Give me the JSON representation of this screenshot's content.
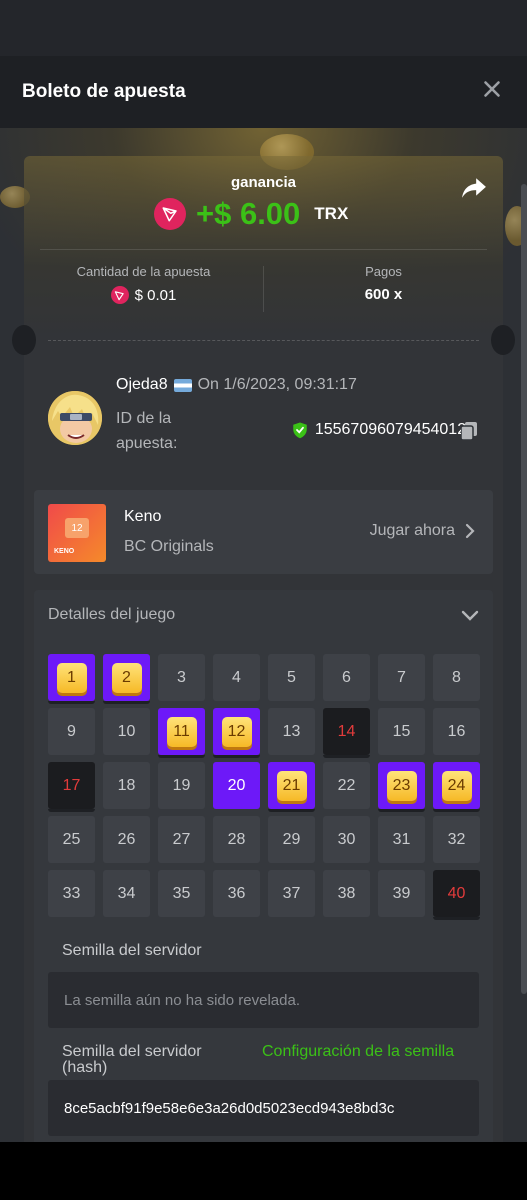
{
  "header": {
    "title": "Boleto de apuesta"
  },
  "win": {
    "label": "ganancia",
    "amount": "+$ 6.00",
    "currency": "TRX"
  },
  "stats": {
    "bet_label": "Cantidad de la apuesta",
    "bet_value": "$ 0.01",
    "payout_label": "Pagos",
    "payout_value": "600 x"
  },
  "player": {
    "name": "Ojeda8",
    "date": "On 1/6/2023, 09:31:17",
    "id_label": "ID de la apuesta:",
    "id_value": "155670960794540128"
  },
  "game": {
    "name": "Keno",
    "provider": "BC Originals",
    "play_label": "Jugar ahora",
    "thumb_number": "12",
    "thumb_label": "KENO"
  },
  "details": {
    "title": "Detalles del juego",
    "cells": [
      {
        "n": "1",
        "state": "hit"
      },
      {
        "n": "2",
        "state": "hit"
      },
      {
        "n": "3",
        "state": "none"
      },
      {
        "n": "4",
        "state": "none"
      },
      {
        "n": "5",
        "state": "none"
      },
      {
        "n": "6",
        "state": "none"
      },
      {
        "n": "7",
        "state": "none"
      },
      {
        "n": "8",
        "state": "none"
      },
      {
        "n": "9",
        "state": "none"
      },
      {
        "n": "10",
        "state": "none"
      },
      {
        "n": "11",
        "state": "hit"
      },
      {
        "n": "12",
        "state": "hit"
      },
      {
        "n": "13",
        "state": "none"
      },
      {
        "n": "14",
        "state": "miss"
      },
      {
        "n": "15",
        "state": "none"
      },
      {
        "n": "16",
        "state": "none"
      },
      {
        "n": "17",
        "state": "miss"
      },
      {
        "n": "18",
        "state": "none"
      },
      {
        "n": "19",
        "state": "none"
      },
      {
        "n": "20",
        "state": "picked"
      },
      {
        "n": "21",
        "state": "hit"
      },
      {
        "n": "22",
        "state": "none"
      },
      {
        "n": "23",
        "state": "hit"
      },
      {
        "n": "24",
        "state": "hit"
      },
      {
        "n": "25",
        "state": "none"
      },
      {
        "n": "26",
        "state": "none"
      },
      {
        "n": "27",
        "state": "none"
      },
      {
        "n": "28",
        "state": "none"
      },
      {
        "n": "29",
        "state": "none"
      },
      {
        "n": "30",
        "state": "none"
      },
      {
        "n": "31",
        "state": "none"
      },
      {
        "n": "32",
        "state": "none"
      },
      {
        "n": "33",
        "state": "none"
      },
      {
        "n": "34",
        "state": "none"
      },
      {
        "n": "35",
        "state": "none"
      },
      {
        "n": "36",
        "state": "none"
      },
      {
        "n": "37",
        "state": "none"
      },
      {
        "n": "38",
        "state": "none"
      },
      {
        "n": "39",
        "state": "none"
      },
      {
        "n": "40",
        "state": "miss"
      }
    ],
    "server_seed_label": "Semilla del servidor",
    "server_seed_value": "La semilla aún no ha sido revelada.",
    "server_hash_label": "Semilla del servidor (hash)",
    "seed_config_link": "Configuración de la semilla",
    "server_hash_value": "8ce5acbf91f9e58e6e3a26d0d5023ecd943e8bd3c"
  },
  "colors": {
    "accent_green": "#3bc117",
    "keno_purple": "#6d19f8",
    "miss_red": "#e23b3b",
    "trx_red": "#e0245e"
  },
  "icons": [
    "close-icon",
    "share-icon",
    "trx-icon",
    "copy-icon",
    "shield-check-icon",
    "chevron-right-icon",
    "chevron-down-icon",
    "flag-argentina-icon"
  ]
}
